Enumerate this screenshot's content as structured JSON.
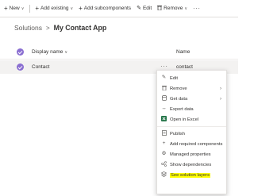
{
  "toolbar": {
    "new_label": "New",
    "add_existing_label": "Add existing",
    "add_subcomponents_label": "Add subcomponents",
    "edit_label": "Edit",
    "remove_label": "Remove",
    "more_label": "···"
  },
  "breadcrumb": {
    "parent": "Solutions",
    "separator": ">",
    "current": "My Contact App"
  },
  "grid": {
    "columns": {
      "display_name": "Display name",
      "name": "Name"
    },
    "row": {
      "display_name": "Contact",
      "name": "contact",
      "more": "···"
    }
  },
  "context_menu": {
    "items": [
      {
        "label": "Edit",
        "icon": "pencil-icon"
      },
      {
        "label": "Remove",
        "icon": "trash-icon",
        "submenu": true
      },
      {
        "label": "Get data",
        "icon": "database-icon",
        "submenu": true
      },
      {
        "label": "Export data",
        "icon": "arrows-icon"
      },
      {
        "label": "Open in Excel",
        "icon": "excel-icon"
      },
      {
        "label": "Publish",
        "icon": "document-icon"
      },
      {
        "label": "Add required components",
        "icon": "plus-icon"
      },
      {
        "label": "Managed properties",
        "icon": "gear-icon"
      },
      {
        "label": "Show dependencies",
        "icon": "dependencies-icon"
      },
      {
        "label": "See solution layers",
        "icon": "layers-icon",
        "highlighted": true
      }
    ]
  },
  "colors": {
    "accent": "#8a6ed1",
    "selected_row": "#f3f2f1",
    "highlight": "#ffff00",
    "excel": "#217346"
  }
}
